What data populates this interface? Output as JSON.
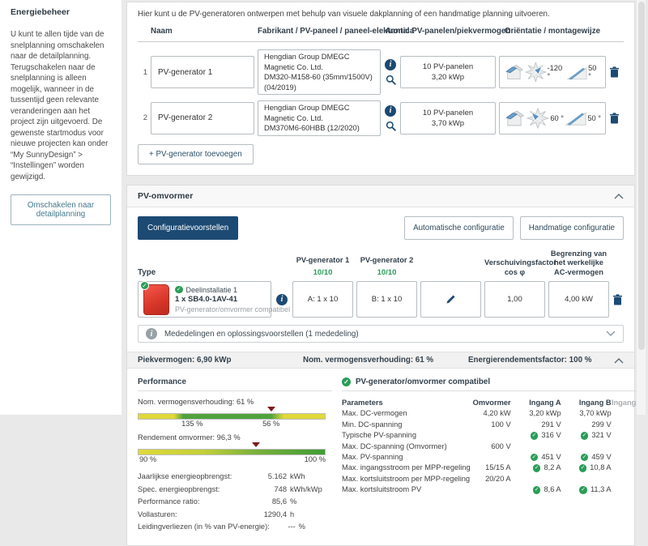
{
  "sidebar": {
    "title": "Energiebeheer",
    "body": "U kunt te allen tijde van de snelplanning omschakelen naar de detailplanning. Terugschakelen naar de snelplanning is alleen mogelijk, wanneer in de tussentijd geen relevante veranderingen aan het project zijn uitgevoerd. De gewenste startmodus voor nieuwe projecten kan onder “My SunnyDesign” > “Instellingen” worden gewijzigd.",
    "switch_button": "Omschakelen naar detailplanning"
  },
  "generators": {
    "intro": "Hier kunt u de PV-generatoren ontwerpen met behulp van visuele dakplanning of een handmatige planning uitvoeren.",
    "headers": {
      "name": "Naam",
      "manufacturer": "Fabrikant / PV-paneel / paneel-elektronica",
      "count": "Aantal PV-panelen/piekvermogen",
      "orientation": "Oriëntatie / montagewijze"
    },
    "rows": [
      {
        "index": "1",
        "name": "PV-generator 1",
        "manufacturer": "Hengdian Group DMEGC Magnetic Co. Ltd.",
        "panel": "DM320-M158-60 (35mm/1500V) (04/2019)",
        "panels": "10 PV-panelen",
        "power": "3,20 kWp",
        "azimuth": "-120 °",
        "tilt": "50 °"
      },
      {
        "index": "2",
        "name": "PV-generator 2",
        "manufacturer": "Hengdian Group DMEGC Magnetic Co. Ltd.",
        "panel": "DM370M6-60HBB (12/2020)",
        "panels": "10 PV-panelen",
        "power": "3,70 kWp",
        "azimuth": "60 °",
        "tilt": "50 °"
      }
    ],
    "add_button": "+ PV-generator toevoegen"
  },
  "inverter": {
    "title": "PV-omvormer",
    "proposals_button": "Configuratievoorstellen",
    "auto_button": "Automatische configuratie",
    "manual_button": "Handmatige configuratie",
    "type_header": "Type",
    "gen1_header": "PV-generator 1",
    "gen1_status": "10/10",
    "gen2_header": "PV-generator 2",
    "gen2_status": "10/10",
    "cos_header": "Verschuivingsfactor cos φ",
    "ac_header": "Begrenzing van het werkelijke AC-vermogen",
    "unit": {
      "name": "Deelinstallatie 1",
      "model": "1 x SB4.0-1AV-41",
      "status": "PV-generator/omvormer compatibel",
      "input_a": "A: 1 x 10",
      "input_b": "B: 1 x 10",
      "cos": "1,00",
      "ac_limit": "4,00 kW"
    },
    "messages": "Mededelingen en oplossingsvoorstellen (1 mededeling)"
  },
  "summary": {
    "peak": "Piekvermogen: 6,90 kWp",
    "ratio": "Nom. vermogensverhouding: 61 %",
    "factor": "Energierendementsfactor: 100 %"
  },
  "performance": {
    "title": "Performance",
    "bar1_label": "Nom. vermogensverhouding: 61 %",
    "bar1_ticks": [
      "135 %",
      "56 %"
    ],
    "bar2_label": "Rendement omvormer: 96,3 %",
    "bar2_ticks": [
      "90 %",
      "100 %"
    ],
    "stats": [
      {
        "label": "Jaarlijkse energieopbrengst:",
        "value": "5.162",
        "unit": "kWh"
      },
      {
        "label": "Spec. energieopbrengst:",
        "value": "748",
        "unit": "kWh/kWp"
      },
      {
        "label": "Performance ratio:",
        "value": "85,6",
        "unit": "%"
      },
      {
        "label": "Vollasturen:",
        "value": "1290,4",
        "unit": "h"
      },
      {
        "label": "Leidingverliezen (in % van PV-energie):",
        "value": "---",
        "unit": "%"
      }
    ]
  },
  "parameters": {
    "title": "PV-generator/omvormer compatibel",
    "headers": [
      "Parameters",
      "Omvormer",
      "Ingang A",
      "Ingang B",
      "Ingang C"
    ],
    "rows": [
      {
        "label": "Max. DC-vermogen",
        "inverter": "4,20 kW",
        "input_a": "3,20 kWp",
        "input_b": "3,70 kWp"
      },
      {
        "label": "Min. DC-spanning",
        "inverter": "100 V",
        "input_a": "291 V",
        "input_b": "299 V"
      },
      {
        "label": "Typische PV-spanning",
        "inverter": "",
        "input_a": "316 V",
        "input_b": "321 V"
      },
      {
        "label": "Max. DC-spanning (Omvormer)",
        "inverter": "600 V",
        "input_a": "",
        "input_b": ""
      },
      {
        "label": "Max. PV-spanning",
        "inverter": "",
        "input_a": "451 V",
        "input_b": "459 V"
      },
      {
        "label": "Max. ingangsstroom per MPP-regeling",
        "inverter": "15/15 A",
        "input_a": "8,2 A",
        "input_b": "10,8 A"
      },
      {
        "label": "Max. kortsluitstroom per MPP-regeling",
        "inverter": "20/20 A",
        "input_a": "",
        "input_b": ""
      },
      {
        "label": "Max. kortsluitstroom PV",
        "inverter": "",
        "input_a": "8,6 A",
        "input_b": "11,3 A"
      }
    ]
  },
  "colors": {
    "accent_navy": "#1c4a73",
    "status_green": "#2a9d57",
    "bar_yellow": "#dfd93a",
    "bar_green": "#3f9c35",
    "marker_red": "#7c1b1b",
    "inverter_red": "#d63528"
  }
}
